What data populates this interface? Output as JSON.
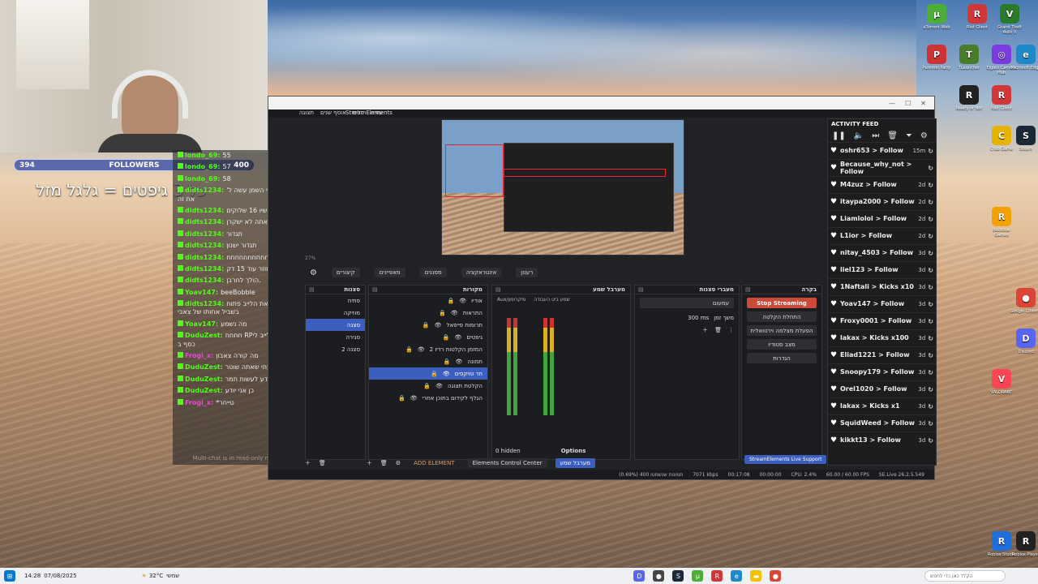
{
  "webcam": {
    "followers_label": "FOLLOWERS",
    "followers_current": "394",
    "followers_goal": "400",
    "goal_text": "כל 3 גיפטים = גלגל מזל"
  },
  "chat": {
    "lines": [
      {
        "user": "londo_69:",
        "msg": "55",
        "color": "#53fc18"
      },
      {
        "user": "londo_69:",
        "msg": "57",
        "color": "#53fc18"
      },
      {
        "user": "londo_69:",
        "msg": "58",
        "color": "#53fc18"
      },
      {
        "user": "didts1234:",
        "msg": "אוי צאבי השמן עשה ל' את זה",
        "color": "#53fc18"
      },
      {
        "user": "didts1234:",
        "msg": "עכשיו 16 שלוקים",
        "color": "#53fc18"
      },
      {
        "user": "didts1234:",
        "msg": "אתה לא ישקרן",
        "color": "#53fc18"
      },
      {
        "user": "didts1234:",
        "msg": "תגדור",
        "color": "#53fc18"
      },
      {
        "user": "didts1234:",
        "msg": "תגדור ישנון",
        "color": "#53fc18"
      },
      {
        "user": "didts1234:",
        "msg": "חחחחחחחחחחח",
        "color": "#53fc18"
      },
      {
        "user": "didts1234:",
        "msg": "חוזר עוד 15 דק.",
        "color": "#53fc18"
      },
      {
        "user": "didts1234:",
        "msg": "הולך לחרבן.",
        "color": "#53fc18"
      },
      {
        "user": "Yoav147:",
        "msg": "beeBobble",
        "color": "#53fc18"
      },
      {
        "user": "didts1234:",
        "msg": "משאיר את הלייב פתוח בשביל אחותו של צאבי",
        "color": "#53fc18"
      },
      {
        "user": "Yoav147:",
        "msg": "מה נשמע",
        "color": "#53fc18"
      },
      {
        "user": "DuduZest:",
        "msg": "חחחח RPאתה הלייב לי כסף ב",
        "color": "#53fc18"
      },
      {
        "user": "Frogi_x:",
        "msg": "מה קורה צאבון",
        "color": "#e44bd6"
      },
      {
        "user": "DuduZest:",
        "msg": "שמעתי שאתה שוטר",
        "color": "#53fc18"
      },
      {
        "user": "DuduZest:",
        "msg": "כן אני יודע לעשות תמר",
        "color": "#53fc18"
      },
      {
        "user": "DuduZest:",
        "msg": "כן אני יודע",
        "color": "#53fc18"
      },
      {
        "user": "Frogi_x:",
        "msg": "*טייחר",
        "color": "#e44bd6"
      }
    ],
    "footer": "Multi-chat is in read-only mode"
  },
  "obs": {
    "window_title": "StreamElements",
    "menu": [
      "StreamElements",
      "עזרה",
      "כלים",
      "אוסף שנים",
      "תצוגה"
    ],
    "zoom": "27%",
    "toolbar": [
      "קיצורים",
      "מאפיינים",
      "מסננים",
      "אינטראקציה",
      "רענון"
    ],
    "scenes_title": "סצנות",
    "scenes": [
      "פתיח",
      "מוזיקה",
      "סצנה",
      "סגירה",
      "סצנה 2"
    ],
    "scenes_selected": 2,
    "sources_title": "מקורות",
    "sources": [
      "אודיו",
      "התראות",
      "תרומות פייפאל",
      "גיפטים",
      "המזמן הקלטות רדיו 2",
      "תמונה",
      "חד טויקסים",
      "הקלטת תצוגה",
      "הגלף לקידום בתוכן אחרי"
    ],
    "sources_selected": 6,
    "mixer_title": "מערבל שמע",
    "mixer_channels": [
      "Aux/מיקרופון",
      "שמע ביט העבודה"
    ],
    "mixer_hidden": "0 hidden",
    "mixer_options": "Options",
    "trans_title": "מעברי סצנות",
    "trans_type": "עמעום",
    "trans_duration_label": "משך זמן",
    "trans_duration": "300 ms",
    "controls_title": "בקרה",
    "controls": [
      "Stop Streaming",
      "התחלת הקלטה",
      "הפעלת מצלמה וירטואלית",
      "מצב סטודיו",
      "הגדרות"
    ],
    "bottom": {
      "add_element": "ADD ELEMENT",
      "elements_cc": "Elements Control Center",
      "mixer_tab": "מערבל שמע",
      "support": "StreamElements Live Support"
    },
    "status": [
      "(0.69%) תמונות שנשמטו 400",
      "7071 kbps",
      "00:17:08",
      "00:00:00",
      "CPU: 2.4%",
      "60.00 / 60.00 FPS",
      "SE.Live 26.2.5.549"
    ]
  },
  "feed": {
    "title": "ACTIVITY FEED",
    "items": [
      {
        "who": "oshr653 > Follow",
        "time": "15m"
      },
      {
        "who": "Because_why_not > Follow",
        "time": ""
      },
      {
        "who": "M4zuz > Follow",
        "time": "2d"
      },
      {
        "who": "itaypa2000 > Follow",
        "time": "2d"
      },
      {
        "who": "Liamlolol > Follow",
        "time": "2d"
      },
      {
        "who": "L1ior > Follow",
        "time": "2d"
      },
      {
        "who": "nitay_4503 > Follow",
        "time": "3d"
      },
      {
        "who": "liel123 > Follow",
        "time": "3d"
      },
      {
        "who": "1Naftali > Kicks x10",
        "time": "3d"
      },
      {
        "who": "Yoav147 > Follow",
        "time": "3d"
      },
      {
        "who": "Froxy0001 > Follow",
        "time": "3d"
      },
      {
        "who": "lakax > Kicks x100",
        "time": "3d"
      },
      {
        "who": "Eliad1221 > Follow",
        "time": "3d"
      },
      {
        "who": "Snoopy179 > Follow",
        "time": "3d"
      },
      {
        "who": "Orel1020 > Follow",
        "time": "3d"
      },
      {
        "who": "lakax > Kicks x1",
        "time": "3d"
      },
      {
        "who": "SquidWeed > Follow",
        "time": "3d"
      },
      {
        "who": "kikkt13 > Follow",
        "time": "3d"
      }
    ]
  },
  "desktop_icons": [
    {
      "label": "uTorrent Web",
      "color": "#4cae36",
      "glyph": "μ"
    },
    {
      "label": "Riot Client",
      "color": "#d13639",
      "glyph": "R"
    },
    {
      "label": "Grand Theft Auto V",
      "color": "#2b7a2b",
      "glyph": "V"
    },
    {
      "label": "Pummel Party",
      "color": "#c33",
      "glyph": "P"
    },
    {
      "label": "TLauncher",
      "color": "#4a7d2a",
      "glyph": "T"
    },
    {
      "label": "Elgato Camera Hub",
      "color": "#7a3be0",
      "glyph": "◎"
    },
    {
      "label": "Microsoft Edge",
      "color": "#1e88c8",
      "glyph": "e"
    },
    {
      "label": "Ready or Not",
      "color": "#222",
      "glyph": "R"
    },
    {
      "label": "Riot Client",
      "color": "#d13639",
      "glyph": "R"
    },
    {
      "label": "Crab Game",
      "color": "#e6b400",
      "glyph": "C"
    },
    {
      "label": "Rockstar Games",
      "color": "#f2a100",
      "glyph": "R"
    },
    {
      "label": "Steam",
      "color": "#1b2838",
      "glyph": "S"
    },
    {
      "label": "Google Chrome",
      "color": "#db4437",
      "glyph": "●"
    },
    {
      "label": "Discord",
      "color": "#5865f2",
      "glyph": "D"
    },
    {
      "label": "VALORANT",
      "color": "#fd4556",
      "glyph": "V"
    },
    {
      "label": "Roblox Studio",
      "color": "#1e6fd9",
      "glyph": "R"
    },
    {
      "label": "Roblox Player",
      "color": "#222",
      "glyph": "R"
    }
  ],
  "taskbar": {
    "weather": "32°C",
    "weather_text": "שמשי",
    "time": "14:28",
    "date": "07/08/2025",
    "search_placeholder": "הקלד כאן כדי לחפש"
  }
}
